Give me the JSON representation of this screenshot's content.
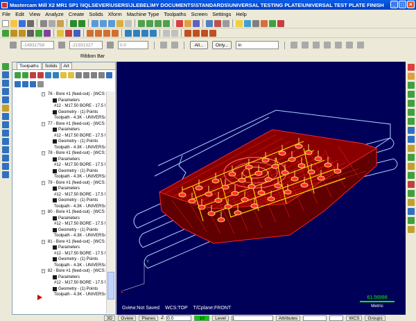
{
  "title": "Mastercam Mill X2 MR1 SP1   \\\\IQLSEVER\\USERS\\JLEBEL\\MY DOCUMENTS\\STANDARDS\\UNIVERSAL TESTING PLATE\\UNIVERSAL TEST PLATE FINISHED REVIS...",
  "menu": [
    "File",
    "Edit",
    "View",
    "Analyze",
    "Create",
    "Solids",
    "Xform",
    "Machine Type",
    "Toolpaths",
    "Screen",
    "Settings",
    "Help"
  ],
  "ribbon": {
    "field_x": "-14931758",
    "field_y": "-21931327",
    "field_z": "0.0",
    "all_label": "All...",
    "only_label": "Only...",
    "in_value": "In",
    "label": "Ribbon Bar"
  },
  "manager": {
    "tabs": [
      "Toolpaths",
      "Solids",
      "Art"
    ],
    "rows": [
      {
        "type": "op",
        "text": "76 - Bore #1 (feed-out) - [WCS:"
      },
      {
        "type": "child",
        "text": "Parameters"
      },
      {
        "type": "child",
        "text": "#12 - M17.50 BORE - 17.5 M"
      },
      {
        "type": "child",
        "text": "Geometry - (1) Points"
      },
      {
        "type": "child",
        "text": "Toolpath - 4.3K - UNIVERSA"
      },
      {
        "type": "op",
        "text": "77 - Bore #1 (feed-out) - [WCS:"
      },
      {
        "type": "child",
        "text": "Parameters"
      },
      {
        "type": "child",
        "text": "#12 - M17.50 BORE - 17.5 M"
      },
      {
        "type": "child",
        "text": "Geometry - (1) Points"
      },
      {
        "type": "child",
        "text": "Toolpath - 4.3K - UNIVERSA"
      },
      {
        "type": "op",
        "text": "78 - Bore #1 (feed-out) - [WCS:"
      },
      {
        "type": "child",
        "text": "Parameters"
      },
      {
        "type": "child",
        "text": "#12 - M17.50 BORE - 17.5 M"
      },
      {
        "type": "child",
        "text": "Geometry - (1) Points"
      },
      {
        "type": "child",
        "text": "Toolpath - 4.3K - UNIVERSA"
      },
      {
        "type": "op",
        "text": "79 - Bore #1 (feed-out) - [WCS:"
      },
      {
        "type": "child",
        "text": "Parameters"
      },
      {
        "type": "child",
        "text": "#12 - M17.50 BORE - 17.5 M"
      },
      {
        "type": "child",
        "text": "Geometry - (1) Points"
      },
      {
        "type": "child",
        "text": "Toolpath - 4.3K - UNIVERSA"
      },
      {
        "type": "op",
        "text": "80 - Bore #1 (feed-out) - [WCS:"
      },
      {
        "type": "child",
        "text": "Parameters"
      },
      {
        "type": "child",
        "text": "#12 - M17.50 BORE - 17.5 M"
      },
      {
        "type": "child",
        "text": "Geometry - (1) Points"
      },
      {
        "type": "child",
        "text": "Toolpath - 4.3K - UNIVERSA"
      },
      {
        "type": "op",
        "text": "81 - Bore #1 (feed-out) - [WCS:"
      },
      {
        "type": "child",
        "text": "Parameters"
      },
      {
        "type": "child",
        "text": "#12 - M17.50 BORE - 17.5 M"
      },
      {
        "type": "child",
        "text": "Geometry - (1) Points"
      },
      {
        "type": "child",
        "text": "Toolpath - 4.3K - UNIVERSA"
      },
      {
        "type": "op",
        "text": "82 - Bore #1 (feed-out) - [WCS:"
      },
      {
        "type": "child",
        "text": "Parameters"
      },
      {
        "type": "child",
        "text": "#12 - M17.50 BORE - 17.5 M"
      },
      {
        "type": "child",
        "text": "Geometry - (1) Points"
      },
      {
        "type": "child",
        "text": "Toolpath - 4.3K - UNIVERSA"
      }
    ]
  },
  "viewport": {
    "gview": "Gview:Not Saved",
    "wcs": "WCS:TOP",
    "tplane": "T/Cplane:FRONT",
    "metric_value": "61.56998",
    "metric_unit": "Metric"
  },
  "statusbar": {
    "mode": "3D",
    "gview": "Gview",
    "planes": "Planes",
    "z_label": "Z",
    "z_value": "0.0",
    "level_color": "10",
    "level_label": "Level",
    "level_value": "1",
    "attributes": "Attributes",
    "wcs": "WCS",
    "groups": "Groups"
  },
  "colors": {
    "viewport_bg": "#000058",
    "part": "#ff1010",
    "toolpath": "#ffd000",
    "wire": "#b0d0ff"
  }
}
